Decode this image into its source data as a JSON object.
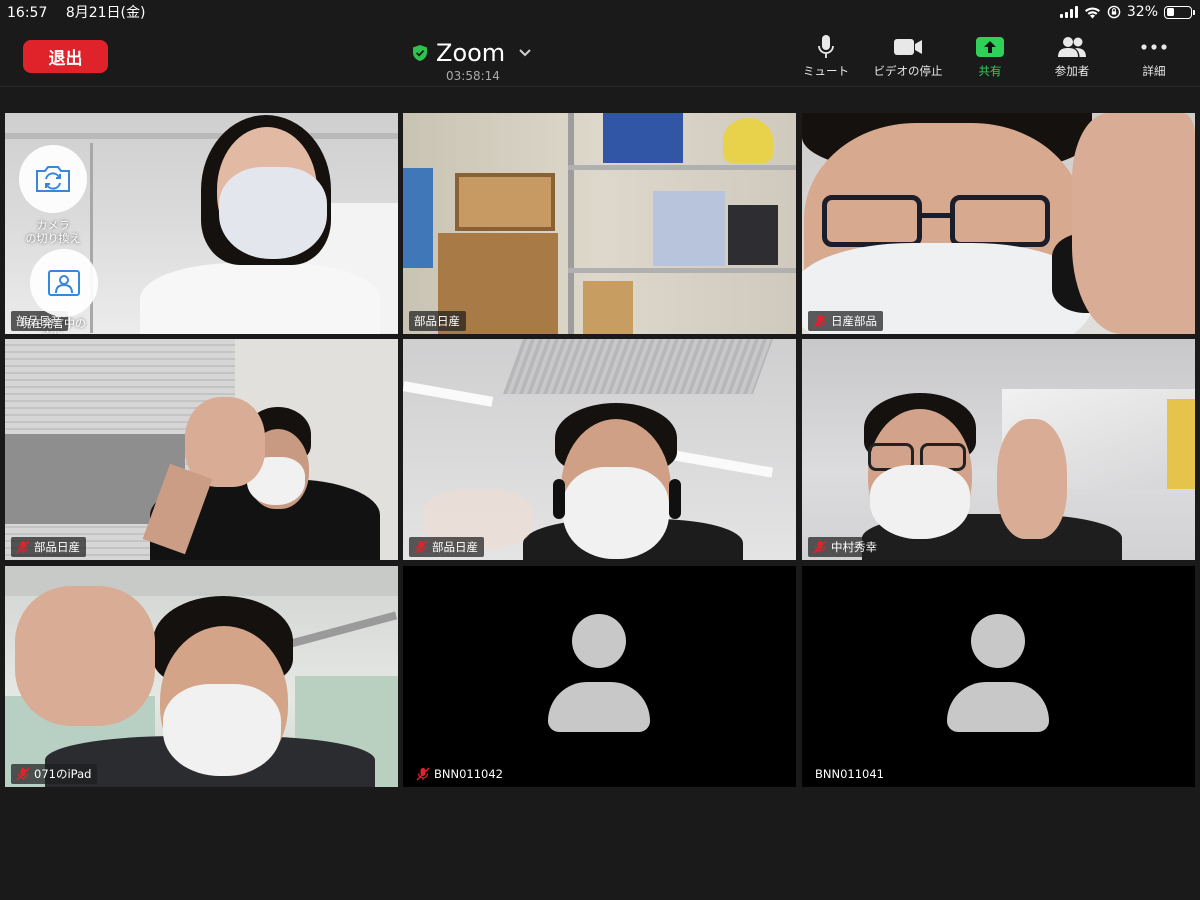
{
  "status_bar": {
    "time": "16:57",
    "date": "8月21日(金)",
    "battery": "32%",
    "battery_level": 0.32
  },
  "toolbar": {
    "leave_label": "退出",
    "title": "Zoom",
    "timer": "03:58:14",
    "buttons": [
      {
        "label": "ミュート",
        "icon": "microphone-icon"
      },
      {
        "label": "ビデオの停止",
        "icon": "video-camera-icon"
      },
      {
        "label": "共有",
        "icon": "share-upload-icon"
      },
      {
        "label": "参加者",
        "icon": "participants-icon"
      },
      {
        "label": "詳細",
        "icon": "more-dots-icon"
      }
    ]
  },
  "self_view_controls": {
    "switch_camera_label": "カメラ\nの切り換え",
    "switch_view_label": "現在発言中の\n方に\n切り替える"
  },
  "participants": [
    {
      "name": "部品日産",
      "muted": false,
      "video": true,
      "active": true
    },
    {
      "name": "部品日産",
      "muted": false,
      "video": true,
      "active": false
    },
    {
      "name": "日産部品",
      "muted": true,
      "video": true,
      "active": false
    },
    {
      "name": "部品日産",
      "muted": true,
      "video": true,
      "active": false
    },
    {
      "name": "部品日産",
      "muted": true,
      "video": true,
      "active": false
    },
    {
      "name": "中村秀幸",
      "muted": true,
      "video": true,
      "active": false
    },
    {
      "name": "071のiPad",
      "muted": true,
      "video": true,
      "active": false
    },
    {
      "name": "BNN011042",
      "muted": true,
      "video": false,
      "active": false
    },
    {
      "name": "BNN011041",
      "muted": false,
      "video": false,
      "active": false
    }
  ],
  "colors": {
    "leave_red": "#e0232b",
    "share_green": "#2fd158",
    "active_speaker_green": "#31c94b",
    "mute_red": "#e0232b"
  }
}
